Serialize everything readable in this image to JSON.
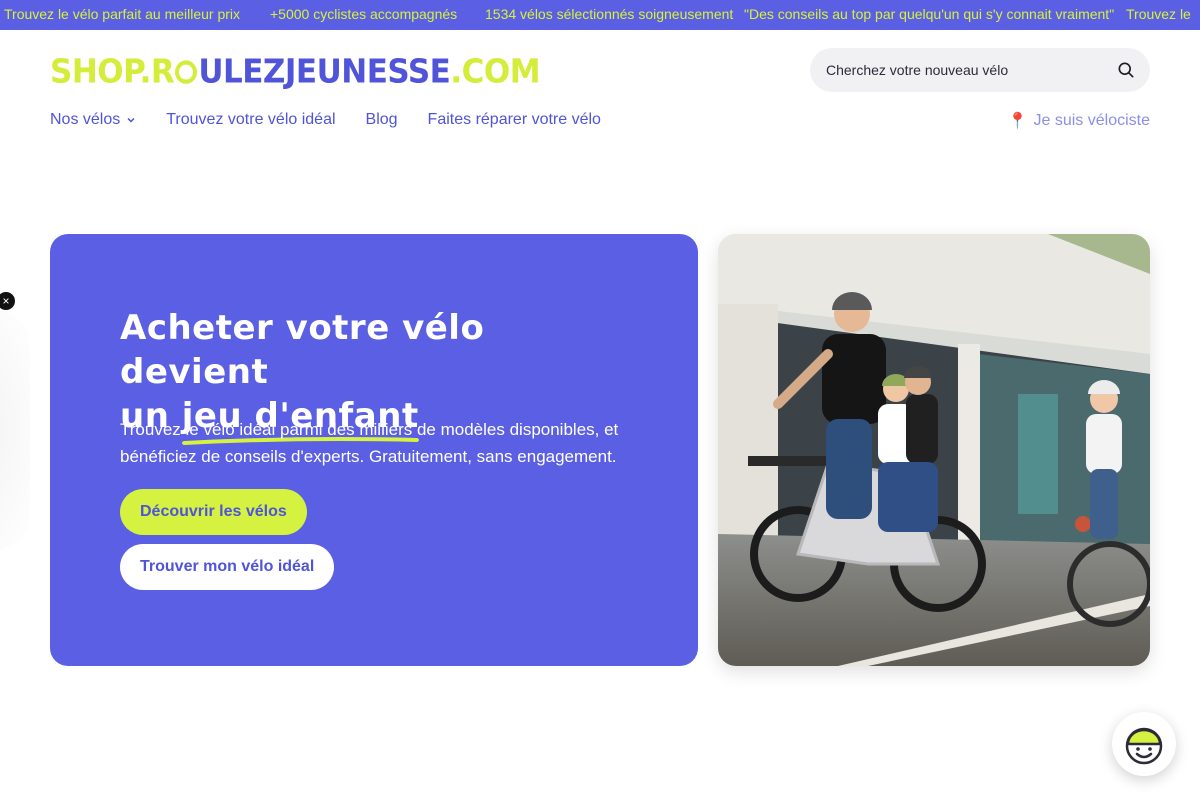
{
  "ticker": {
    "items": [
      "Trouvez le vélo parfait au meilleur prix",
      "+5000 cyclistes accompagnés",
      "1534 vélos sélectionnés soigneusement",
      "\"Des conseils au top par quelqu'un qui s'y connait vraiment\"",
      "Trouvez le"
    ]
  },
  "header": {
    "logo": {
      "part1": "SHOP.R",
      "part2": "ULEZJEUNESSE",
      "part3": ".COM"
    },
    "search": {
      "placeholder": "Cherchez votre nouveau vélo"
    },
    "nav": [
      {
        "label": "Nos vélos"
      },
      {
        "label": "Trouvez votre vélo idéal"
      },
      {
        "label": "Blog"
      },
      {
        "label": "Faites réparer votre vélo"
      }
    ],
    "pro_link": {
      "icon": "📍",
      "label": "Je suis vélociste"
    }
  },
  "hero": {
    "title_line1": "Acheter votre vélo devient",
    "title_prefix": "un ",
    "title_highlight": "jeu d'enfant",
    "subtitle": "Trouvez le vélo idéal parmi des milliers de modèles disponibles, et bénéficiez de conseils d'experts. Gratuitement, sans engagement.",
    "primary_button": "Découvrir les vélos",
    "secondary_button": "Trouver mon vélo idéal"
  },
  "popup": {
    "close": "×"
  },
  "colors": {
    "brand_blue": "#5b5fe3",
    "brand_lime": "#d4f23f",
    "text_blue": "#4f54d8"
  }
}
